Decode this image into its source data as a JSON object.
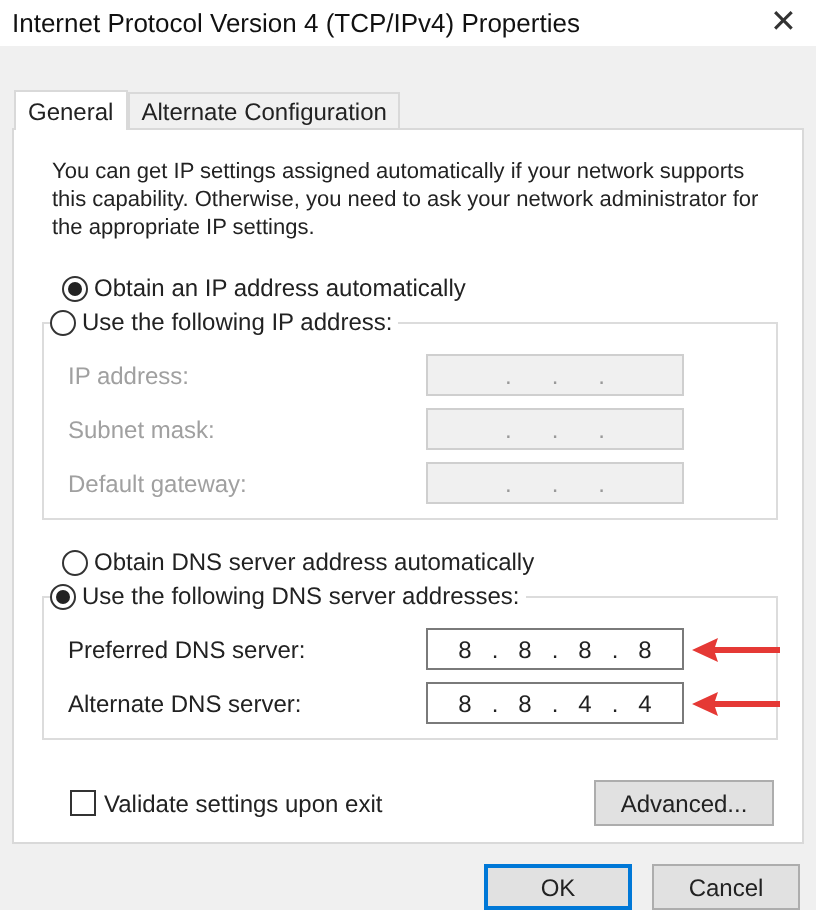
{
  "window": {
    "title": "Internet Protocol Version 4 (TCP/IPv4) Properties",
    "close": "✕"
  },
  "tabs": [
    {
      "label": "General",
      "selected": true
    },
    {
      "label": "Alternate Configuration",
      "selected": false
    }
  ],
  "description": "You can get IP settings assigned automatically if your network supports this capability. Otherwise, you need to ask your network administrator for the appropriate IP settings.",
  "ip_mode": {
    "options": [
      {
        "label": "Obtain an IP address automatically",
        "selected": true
      },
      {
        "label": "Use the following IP address:",
        "selected": false
      }
    ],
    "fields": [
      {
        "label": "IP address:",
        "value": ".      .      .",
        "disabled": true,
        "highlighted": false
      },
      {
        "label": "Subnet mask:",
        "value": ".      .      .",
        "disabled": true,
        "highlighted": false
      },
      {
        "label": "Default gateway:",
        "value": ".      .      .",
        "disabled": true,
        "highlighted": false
      }
    ]
  },
  "dns_mode": {
    "options": [
      {
        "label": "Obtain DNS server address automatically",
        "selected": false
      },
      {
        "label": "Use the following DNS server addresses:",
        "selected": true
      }
    ],
    "fields": [
      {
        "label": "Preferred DNS server:",
        "value": "8   .   8   .   8   .   8",
        "disabled": false,
        "highlighted": true
      },
      {
        "label": "Alternate DNS server:",
        "value": "8   .   8   .   4   .   4",
        "disabled": false,
        "highlighted": true
      }
    ]
  },
  "validate": {
    "label": "Validate settings upon exit",
    "checked": false
  },
  "advanced_button": "Advanced...",
  "buttons": [
    {
      "label": "OK",
      "default": true
    },
    {
      "label": "Cancel",
      "default": false
    }
  ]
}
